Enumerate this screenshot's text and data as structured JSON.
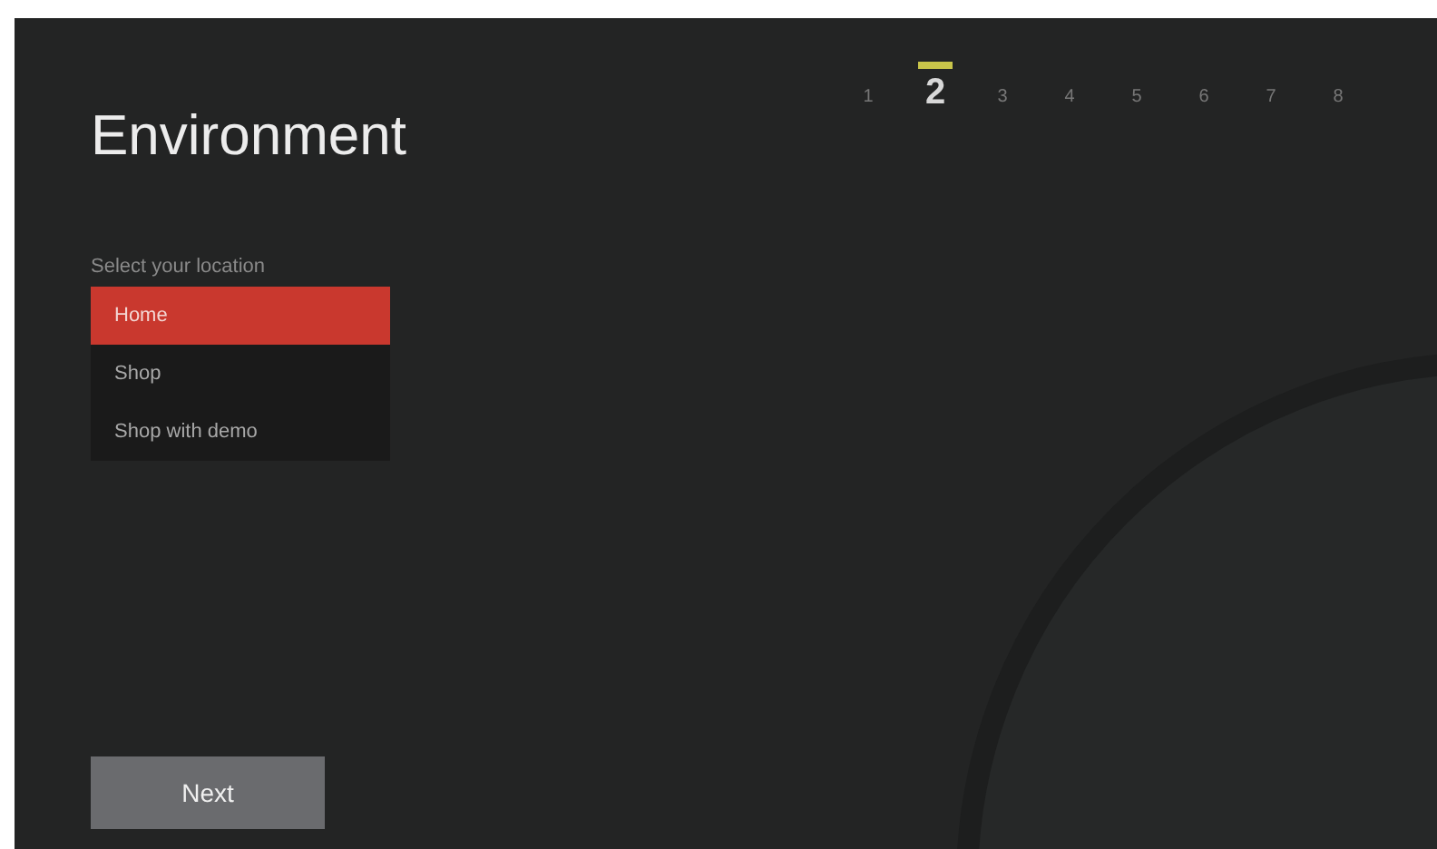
{
  "title": "Environment",
  "steps": [
    {
      "label": "1",
      "selected": false
    },
    {
      "label": "2",
      "selected": true
    },
    {
      "label": "3",
      "selected": false
    },
    {
      "label": "4",
      "selected": false
    },
    {
      "label": "5",
      "selected": false
    },
    {
      "label": "6",
      "selected": false
    },
    {
      "label": "7",
      "selected": false
    },
    {
      "label": "8",
      "selected": false
    }
  ],
  "location": {
    "label": "Select your location",
    "options": [
      {
        "label": "Home",
        "selected": true
      },
      {
        "label": "Shop",
        "selected": false
      },
      {
        "label": "Shop with demo",
        "selected": false
      }
    ]
  },
  "next_button": "Next"
}
